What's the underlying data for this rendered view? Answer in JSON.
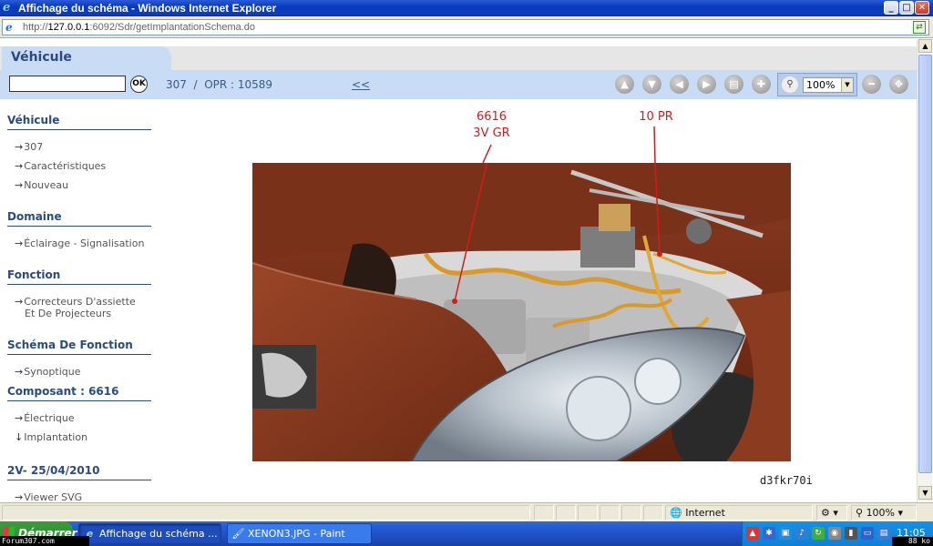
{
  "window": {
    "title": "Affichage du schéma - Windows Internet Explorer",
    "minimize": "_",
    "maximize": "□",
    "close": "✕"
  },
  "address": {
    "prefix": "http://",
    "host": "127.0.0.1",
    "rest": ":6092/Sdr/getImplantationSchema.do"
  },
  "header": {
    "tab_label": "Véhicule",
    "search_value": "",
    "ok_label": "OK",
    "breadcrumb": "307  /  OPR : 10589",
    "back_link": "<<",
    "zoom_value": "100%",
    "toolbar_icons": [
      "up-arrow-icon",
      "down-arrow-icon",
      "left-arrow-icon",
      "right-arrow-icon",
      "print-icon",
      "zoom-in-icon",
      "magnifier-icon",
      "zoom-out-icon",
      "fit-screen-icon"
    ]
  },
  "sidebar": {
    "sections": [
      {
        "title": "Véhicule",
        "items": [
          "307",
          "Caractéristiques",
          "Nouveau"
        ]
      },
      {
        "title": "Domaine",
        "items": [
          "Éclairage - Signalisation"
        ]
      },
      {
        "title": "Fonction",
        "items": [
          "Correcteurs D'assiette",
          "Et De Projecteurs"
        ]
      },
      {
        "title": "Schéma De Fonction",
        "items": [
          "Synoptique"
        ]
      },
      {
        "title": "Composant : 6616",
        "items": [
          "Électrique",
          "Implantation"
        ]
      },
      {
        "title": "2V- 25/04/2010",
        "items": [
          "Viewer SVG"
        ]
      }
    ],
    "arrow_right": "→",
    "arrow_down": "↓"
  },
  "schema": {
    "callout1_line1": "6616",
    "callout1_line2": "3V GR",
    "callout2": "10 PR",
    "image_ref": "d3fkr70i",
    "callout_color": "#d21c1c"
  },
  "statusbar": {
    "zone": "Internet",
    "zoom": "100%"
  },
  "taskbar": {
    "start": "Démarrer",
    "tasks": [
      "Affichage du schéma ...",
      "XENON3.JPG - Paint"
    ],
    "clock": "11:05",
    "watermark": "Forum307.com",
    "filesize": "88 ko"
  },
  "colors": {
    "titlebar": "#0a3bbd",
    "header_blue": "#c9dcf5",
    "sidebar_heading": "#2b4a84",
    "taskbar": "#245edb"
  }
}
